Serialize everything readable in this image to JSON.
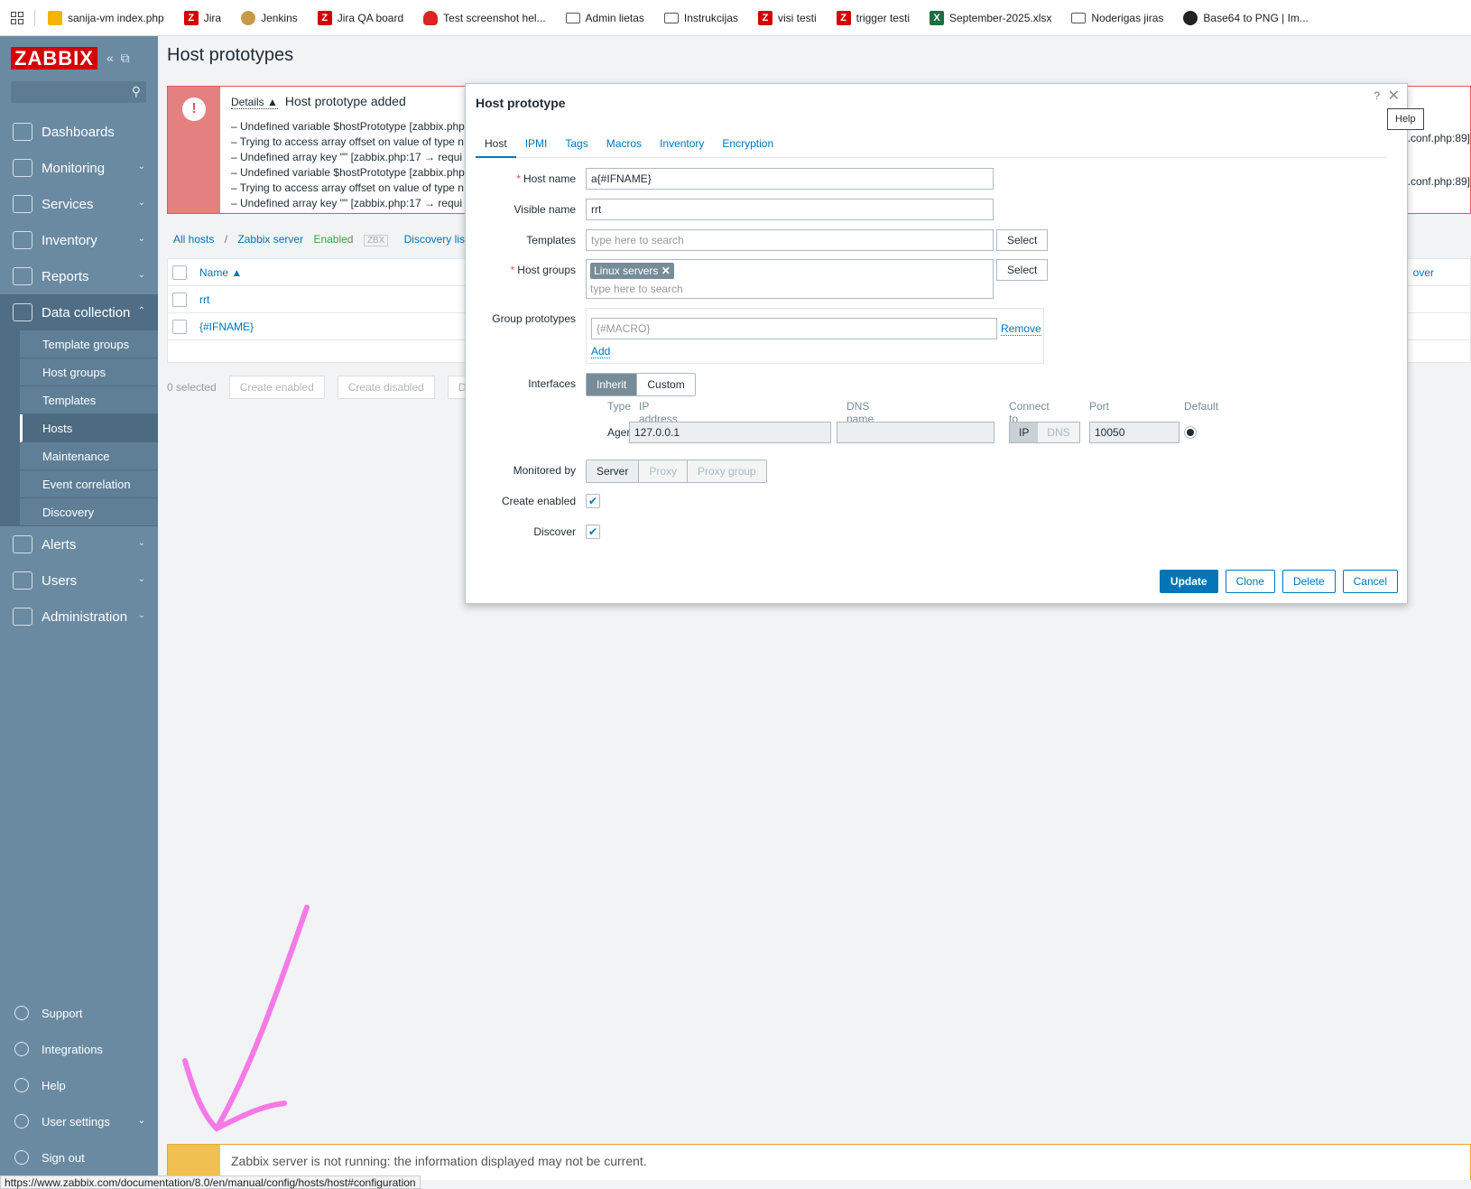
{
  "bookmarks": [
    {
      "label": "sanija-vm index.php",
      "icon": "s"
    },
    {
      "label": "Jira",
      "icon": "z"
    },
    {
      "label": "Jenkins",
      "icon": "j"
    },
    {
      "label": "Jira QA board",
      "icon": "z"
    },
    {
      "label": "Test screenshot hel...",
      "icon": "c"
    },
    {
      "label": "Admin lietas",
      "icon": "f"
    },
    {
      "label": "Instrukcijas",
      "icon": "f"
    },
    {
      "label": "visi testi",
      "icon": "z"
    },
    {
      "label": "trigger testi",
      "icon": "z"
    },
    {
      "label": "September-2025.xlsx",
      "icon": "x"
    },
    {
      "label": "Noderigas jiras",
      "icon": "f"
    },
    {
      "label": "Base64 to PNG | Im...",
      "icon": "k"
    }
  ],
  "sidebar": {
    "logo": "ZABBIX",
    "nav": [
      {
        "label": "Dashboards",
        "name": "dashboards",
        "chevron": ""
      },
      {
        "label": "Monitoring",
        "name": "monitoring",
        "chevron": "⌄"
      },
      {
        "label": "Services",
        "name": "services",
        "chevron": "⌄"
      },
      {
        "label": "Inventory",
        "name": "inventory",
        "chevron": "⌄"
      },
      {
        "label": "Reports",
        "name": "reports",
        "chevron": "⌄"
      },
      {
        "label": "Data collection",
        "name": "data-collection",
        "chevron": "⌃"
      }
    ],
    "sub": [
      "Template groups",
      "Host groups",
      "Templates",
      "Hosts",
      "Maintenance",
      "Event correlation",
      "Discovery"
    ],
    "nav2": [
      {
        "label": "Alerts",
        "name": "alerts"
      },
      {
        "label": "Users",
        "name": "users"
      },
      {
        "label": "Administration",
        "name": "administration"
      }
    ],
    "bottom": [
      {
        "label": "Support",
        "name": "support"
      },
      {
        "label": "Integrations",
        "name": "integrations"
      },
      {
        "label": "Help",
        "name": "help"
      },
      {
        "label": "User settings",
        "name": "user-settings"
      },
      {
        "label": "Sign out",
        "name": "sign-out"
      }
    ]
  },
  "page": {
    "title": "Host prototypes"
  },
  "error": {
    "details": "Details ▲",
    "title": "Host prototype added",
    "lines": [
      "– Undefined variable $hostPrototype [zabbix.php",
      "– Trying to access array offset on value of type n",
      "– Undefined array key \"\" [zabbix.php:17 → requi",
      "– Undefined variable $hostPrototype [zabbix.php",
      "– Trying to access array offset on value of type n",
      "– Undefined array key \"\" [zabbix.php:17 → requi"
    ],
    "right": ".conf.php:89]"
  },
  "breadcrumb": {
    "all": "All hosts",
    "sep": "/",
    "server": "Zabbix server",
    "enabled": "Enabled",
    "zbx": "ZBX",
    "discovery": "Discovery lis"
  },
  "table": {
    "name_header": "Name ▲",
    "rows": [
      "rrt",
      "{#IFNAME}"
    ],
    "right_header": "over"
  },
  "footer": {
    "selected": "0 selected",
    "btn1": "Create enabled",
    "btn2": "Create disabled",
    "btn3": "De"
  },
  "modal": {
    "title": "Host prototype",
    "q": "?",
    "close": "✕",
    "help_tip": "Help",
    "tabs": [
      "Host",
      "IPMI",
      "Tags",
      "Macros",
      "Inventory",
      "Encryption"
    ],
    "host_name_label": "Host name",
    "host_name": "a{#IFNAME}",
    "visible_name_label": "Visible name",
    "visible_name": "rrt",
    "templates_label": "Templates",
    "templates_ph": "type here to search",
    "select": "Select",
    "host_groups_label": "Host groups",
    "host_group_chip": "Linux servers",
    "host_groups_ph": "type here to search",
    "group_proto_label": "Group prototypes",
    "group_proto_ph": "{#MACRO}",
    "remove": "Remove",
    "add": "Add",
    "interfaces_label": "Interfaces",
    "inherit": "Inherit",
    "custom": "Custom",
    "if_headers": {
      "type": "Type",
      "ip": "IP address",
      "dns": "DNS name",
      "connect": "Connect to",
      "port": "Port",
      "default": "Default"
    },
    "agent": "Agent",
    "ip": "127.0.0.1",
    "dns": "",
    "ip_btn": "IP",
    "dns_btn": "DNS",
    "port": "10050",
    "monitored_label": "Monitored by",
    "server": "Server",
    "proxy": "Proxy",
    "proxy_group": "Proxy group",
    "create_enabled_label": "Create enabled",
    "discover_label": "Discover",
    "update": "Update",
    "clone": "Clone",
    "delete": "Delete",
    "cancel": "Cancel"
  },
  "warning": {
    "text": "Zabbix server is not running: the information displayed may not be current."
  },
  "status_url": "https://www.zabbix.com/documentation/8.0/en/manual/config/hosts/host#configuration"
}
